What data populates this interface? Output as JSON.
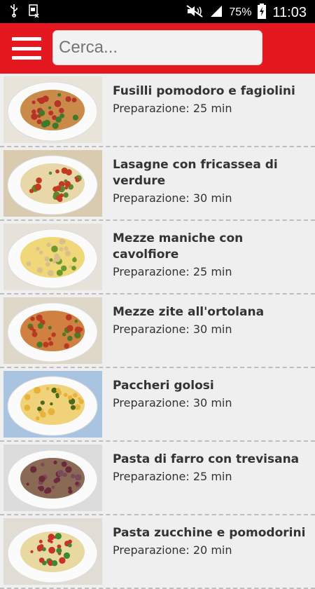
{
  "status_bar": {
    "battery": "75%",
    "time": "11:03",
    "icons": [
      "usb-icon",
      "sim-card-icon",
      "mute-icon",
      "signal-icon",
      "battery-charging-icon"
    ]
  },
  "toolbar": {
    "menu_icon": "hamburger-menu-icon",
    "search_placeholder": "Cerca..."
  },
  "recipes": [
    {
      "title": "Fusilli pomodoro e fagiolini",
      "prep": "Preparazione: 25 min",
      "pasta_color": "#c98a4a",
      "sauce_color": "#b8322a",
      "accent_color": "#3d7a2a",
      "bg_color": "#e9e4da"
    },
    {
      "title": "Lasagne con fricassea di verdure",
      "prep": "Preparazione: 30 min",
      "pasta_color": "#e8d7a8",
      "sauce_color": "#c23a1f",
      "accent_color": "#5a8a30",
      "bg_color": "#d8cbb0"
    },
    {
      "title": "Mezze maniche con cavolfiore",
      "prep": "Preparazione: 25 min",
      "pasta_color": "#f0d77a",
      "sauce_color": "#d9c08a",
      "accent_color": "#6b9a2b",
      "bg_color": "#e7e2d9"
    },
    {
      "title": "Mezze zite all'ortolana",
      "prep": "Preparazione: 30 min",
      "pasta_color": "#d08040",
      "sauce_color": "#b83a22",
      "accent_color": "#4c7a26",
      "bg_color": "#dfd8c8"
    },
    {
      "title": "Paccheri golosi",
      "prep": "Preparazione: 30 min",
      "pasta_color": "#efd27a",
      "sauce_color": "#e6b23a",
      "accent_color": "#4a6a1a",
      "bg_color": "#a9c4e0"
    },
    {
      "title": "Pasta di farro con trevisana",
      "prep": "Preparazione: 25 min",
      "pasta_color": "#8a6a55",
      "sauce_color": "#6a2a3a",
      "accent_color": "#7a4a5a",
      "bg_color": "#dcdcdc"
    },
    {
      "title": "Pasta zucchine e pomodorini",
      "prep": "Preparazione: 20 min",
      "pasta_color": "#e8d9a0",
      "sauce_color": "#c8322a",
      "accent_color": "#3c8a2e",
      "bg_color": "#e2ddd4"
    }
  ]
}
